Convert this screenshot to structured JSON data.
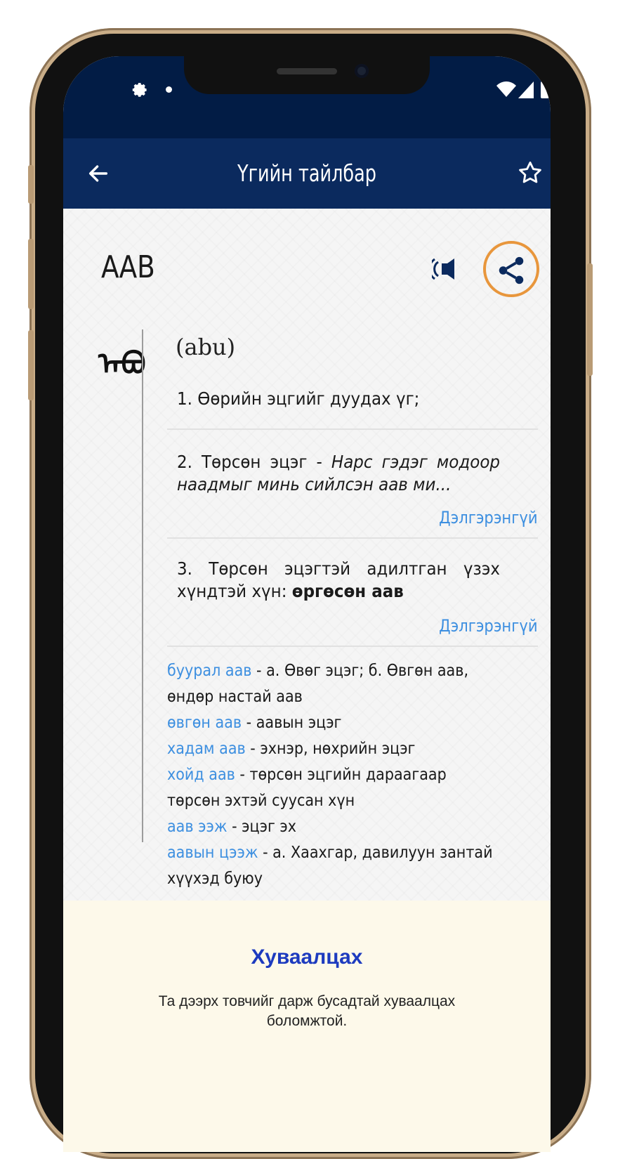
{
  "app_bar": {
    "title": "Үгийн тайлбар",
    "back_icon": "arrow-left-icon",
    "favorite_icon": "star-outline-icon"
  },
  "status_bar": {
    "left_icons": [
      "gear-icon",
      "dot-icon"
    ],
    "right_icons": [
      "wifi-icon",
      "signal-icon",
      "battery-icon"
    ]
  },
  "entry": {
    "word": "ААВ",
    "mongolian_script": "ᠠᠪᠤ",
    "transliteration": "(abu)",
    "sound_icon": "speaker-icon",
    "share_icon": "share-icon",
    "definitions": [
      {
        "text": "1. Өөрийн эцгийг дуудах үг;"
      },
      {
        "text": "2. Төрсөн эцэг - ",
        "example": "Нарс гэдэг модоор наадмыг минь сийлсэн аав ми...",
        "more": "Дэлгэрэнгүй"
      },
      {
        "text": "3. Төрсөн эцэгтэй адилтган үзэх хүндтэй хүн: ",
        "bold": "өргөсөн аав",
        "more": "Дэлгэрэнгүй"
      }
    ],
    "phrases": [
      {
        "term": "буурал аав",
        "meaning": " - а. Өвөг эцэг; б. Өвгөн аав, өндөр настай аав"
      },
      {
        "term": "өвгөн аав",
        "meaning": " - аавын эцэг"
      },
      {
        "term": "хадам аав",
        "meaning": " - эхнэр, нөхрийн эцэг"
      },
      {
        "term": "хойд аав",
        "meaning": " - төрсөн эцгийн дараагаар төрсөн эхтэй суусан хүн"
      },
      {
        "term": "аав ээж",
        "meaning": " - эцэг эх"
      },
      {
        "term": "аавын цээж",
        "meaning": " - а. Хаахгар, давилуун зантай хүүхэд буюу"
      }
    ]
  },
  "tooltip_panel": {
    "title": "Хуваалцах",
    "text": "Та дээрх товчийг дарж бусадтай хуваалцах боломжтой."
  },
  "colors": {
    "status_bar": "#021c45",
    "app_bar": "#0b2a5e",
    "link": "#3d8fe0",
    "highlight_ring": "#e8963c",
    "panel_bg": "#fdf9ea",
    "panel_title": "#1d3bbf",
    "phone_frame": "#c9ad88"
  }
}
